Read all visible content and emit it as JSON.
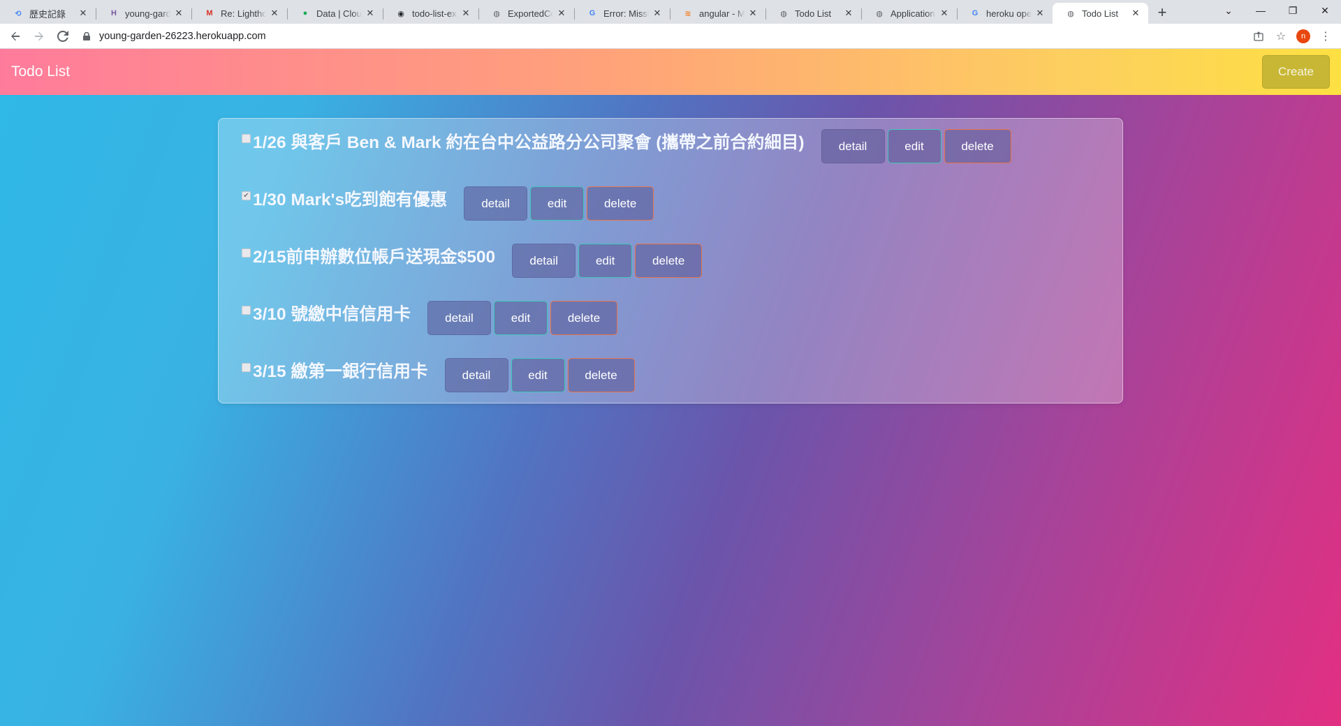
{
  "browser": {
    "tabs": [
      {
        "title": "歷史記錄",
        "favicon": "history-icon",
        "favicon_glyph": "⟲",
        "color": "#4285f4"
      },
      {
        "title": "young-garden",
        "favicon": "heroku-icon",
        "favicon_glyph": "H",
        "color": "#79589f"
      },
      {
        "title": "Re: Lighthouse",
        "favicon": "gmail-icon",
        "favicon_glyph": "M",
        "color": "#d93025"
      },
      {
        "title": "Data | Cloud",
        "favicon": "mongodb-icon",
        "favicon_glyph": "●",
        "color": "#13aa52"
      },
      {
        "title": "todo-list-express",
        "favicon": "github-icon",
        "favicon_glyph": "◉",
        "color": "#24292f"
      },
      {
        "title": "ExportedCon",
        "favicon": "globe-icon",
        "favicon_glyph": "◍",
        "color": "#5f6368"
      },
      {
        "title": "Error: Missing",
        "favicon": "google-icon",
        "favicon_glyph": "G",
        "color": "#4285f4"
      },
      {
        "title": "angular - Mi",
        "favicon": "stackoverflow-icon",
        "favicon_glyph": "≋",
        "color": "#f48024"
      },
      {
        "title": "Todo List",
        "favicon": "globe-icon",
        "favicon_glyph": "◍",
        "color": "#5f6368"
      },
      {
        "title": "Application E",
        "favicon": "globe-icon",
        "favicon_glyph": "◍",
        "color": "#5f6368"
      },
      {
        "title": "heroku open",
        "favicon": "google-icon",
        "favicon_glyph": "G",
        "color": "#4285f4"
      },
      {
        "title": "Todo List",
        "favicon": "globe-icon",
        "favicon_glyph": "◍",
        "color": "#5f6368",
        "active": true
      }
    ],
    "url": "young-garden-26223.herokuapp.com",
    "profile_initial": "n"
  },
  "app": {
    "brand": "Todo List",
    "create_label": "Create",
    "colors": {
      "navbar_start": "#ff7b9b",
      "navbar_end": "#fde042",
      "create_button": "#c8b735",
      "edit_border": "#3ec7b5",
      "delete_border": "#e8744a"
    }
  },
  "todos": [
    {
      "text": "1/26 與客戶 Ben & Mark 約在台中公益路分公司聚會 (攜帶之前合約細目)",
      "done": false
    },
    {
      "text": "1/30 Mark's吃到飽有優惠",
      "done": true
    },
    {
      "text": "2/15前申辦數位帳戶送現金$500",
      "done": false
    },
    {
      "text": "3/10 號繳中信信用卡",
      "done": false
    },
    {
      "text": "3/15 繳第一銀行信用卡",
      "done": false
    }
  ],
  "buttons": {
    "detail": "detail",
    "edit": "edit",
    "delete": "delete"
  }
}
